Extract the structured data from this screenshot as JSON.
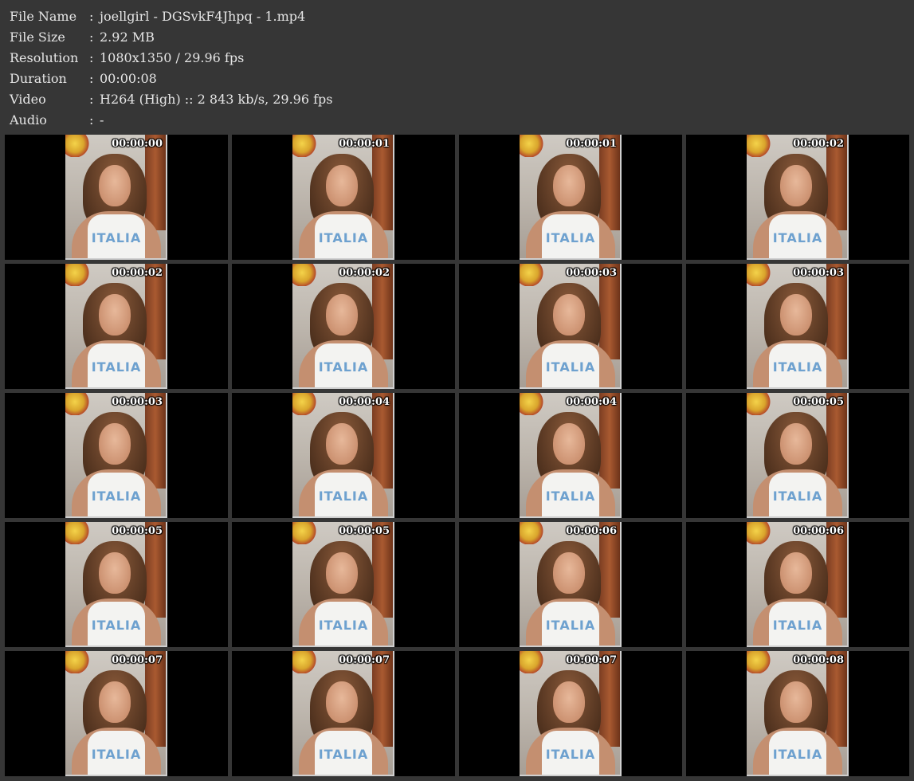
{
  "info": [
    {
      "label": "File Name",
      "sep": ":",
      "value": "joellgirl - DGSvkF4Jhpq - 1.mp4"
    },
    {
      "label": "File Size",
      "sep": ":",
      "value": "2.92 MB"
    },
    {
      "label": "Resolution",
      "sep": ":",
      "value": "1080x1350 / 29.96 fps"
    },
    {
      "label": "Duration",
      "sep": ":",
      "value": "00:00:08"
    },
    {
      "label": "Video",
      "sep": ":",
      "value": "H264 (High) :: 2 843 kb/s, 29.96 fps"
    },
    {
      "label": "Audio",
      "sep": ":",
      "value": "-"
    }
  ],
  "shirt_text": "ITALIA",
  "thumbnails": [
    "00:00:00",
    "00:00:01",
    "00:00:01",
    "00:00:02",
    "00:00:02",
    "00:00:02",
    "00:00:03",
    "00:00:03",
    "00:00:03",
    "00:00:04",
    "00:00:04",
    "00:00:05",
    "00:00:05",
    "00:00:05",
    "00:00:06",
    "00:00:06",
    "00:00:07",
    "00:00:07",
    "00:00:07",
    "00:00:08"
  ]
}
